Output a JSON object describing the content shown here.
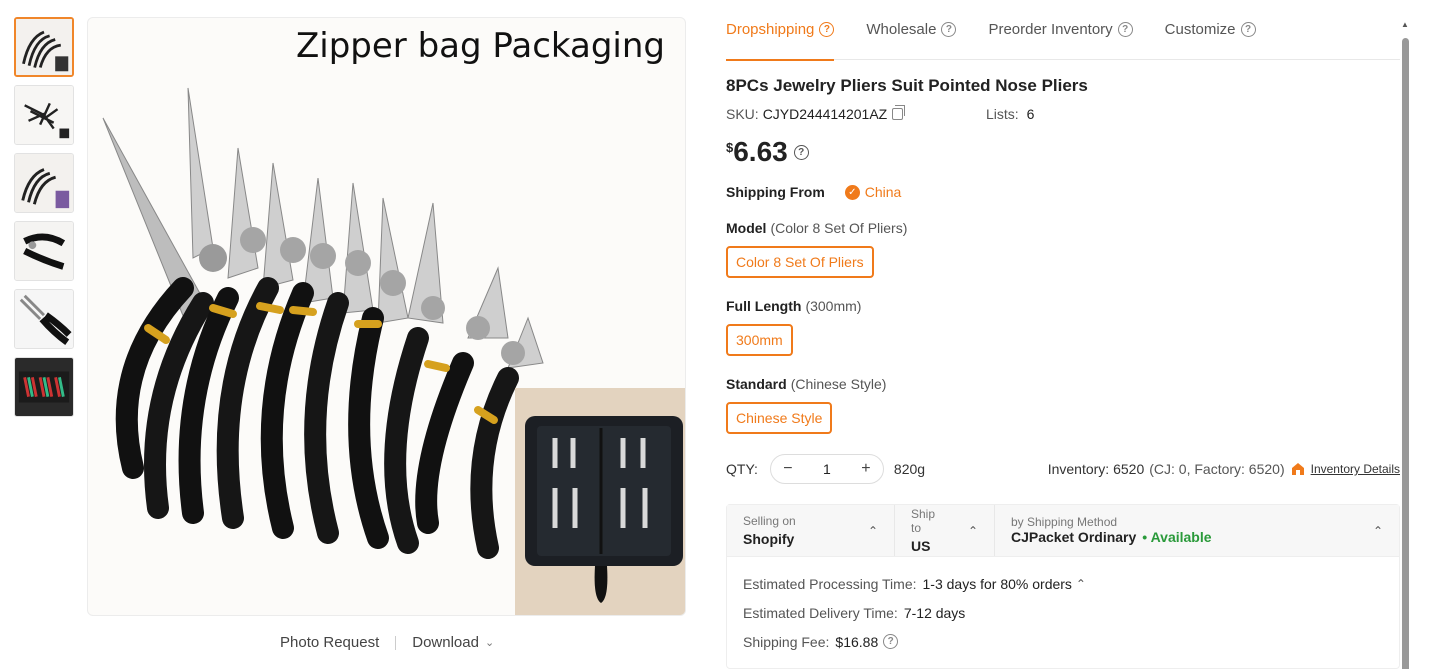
{
  "image": {
    "caption": "Zipper bag Packaging",
    "thumbnails": [
      {
        "name": "thumb-zipper-bag",
        "icon": "pliers-fan-image"
      },
      {
        "name": "thumb-8pcs",
        "icon": "pliers-set-image"
      },
      {
        "name": "thumb-color-packaging",
        "icon": "pliers-fan-image"
      },
      {
        "name": "thumb-single-plier",
        "icon": "single-plier-image"
      },
      {
        "name": "thumb-plier-closeup",
        "icon": "plier-closeup-image"
      },
      {
        "name": "thumb-case",
        "icon": "pliers-case-image"
      }
    ],
    "photo_request": "Photo Request",
    "download": "Download"
  },
  "tabs": [
    {
      "label": "Dropshipping",
      "active": true
    },
    {
      "label": "Wholesale",
      "active": false
    },
    {
      "label": "Preorder Inventory",
      "active": false
    },
    {
      "label": "Customize",
      "active": false
    }
  ],
  "product": {
    "title": "8PCs Jewelry Pliers Suit Pointed Nose Pliers",
    "sku_label": "SKU:",
    "sku": "CJYD244414201AZ",
    "lists_label": "Lists:",
    "lists": "6",
    "currency": "$",
    "price": "6.63"
  },
  "shipping_from": {
    "label": "Shipping From",
    "value": "China"
  },
  "options": [
    {
      "label": "Model",
      "selected_text": "(Color 8 Set Of Pliers)",
      "button": "Color 8 Set Of Pliers"
    },
    {
      "label": "Full Length",
      "selected_text": "(300mm)",
      "button": "300mm"
    },
    {
      "label": "Standard",
      "selected_text": "(Chinese Style)",
      "button": "Chinese Style"
    }
  ],
  "qty": {
    "label": "QTY:",
    "value": "1",
    "weight": "820g",
    "inventory": "Inventory: 6520",
    "inventory_detail": "(CJ: 0, Factory: 6520)",
    "inventory_link": "Inventory Details"
  },
  "shipping": {
    "selling_on_label": "Selling on",
    "selling_on": "Shopify",
    "ship_to_label": "Ship to",
    "ship_to": "US",
    "method_label": "by Shipping Method",
    "method": "CJPacket Ordinary",
    "availability": "• Available",
    "processing_label": "Estimated Processing Time:",
    "processing": "1-3 days for 80% orders",
    "delivery_label": "Estimated Delivery Time:",
    "delivery": "7-12 days",
    "fee_label": "Shipping Fee:",
    "fee": "$16.88"
  },
  "colors": {
    "accent": "#f07a1a",
    "available": "#2a9a3a"
  }
}
